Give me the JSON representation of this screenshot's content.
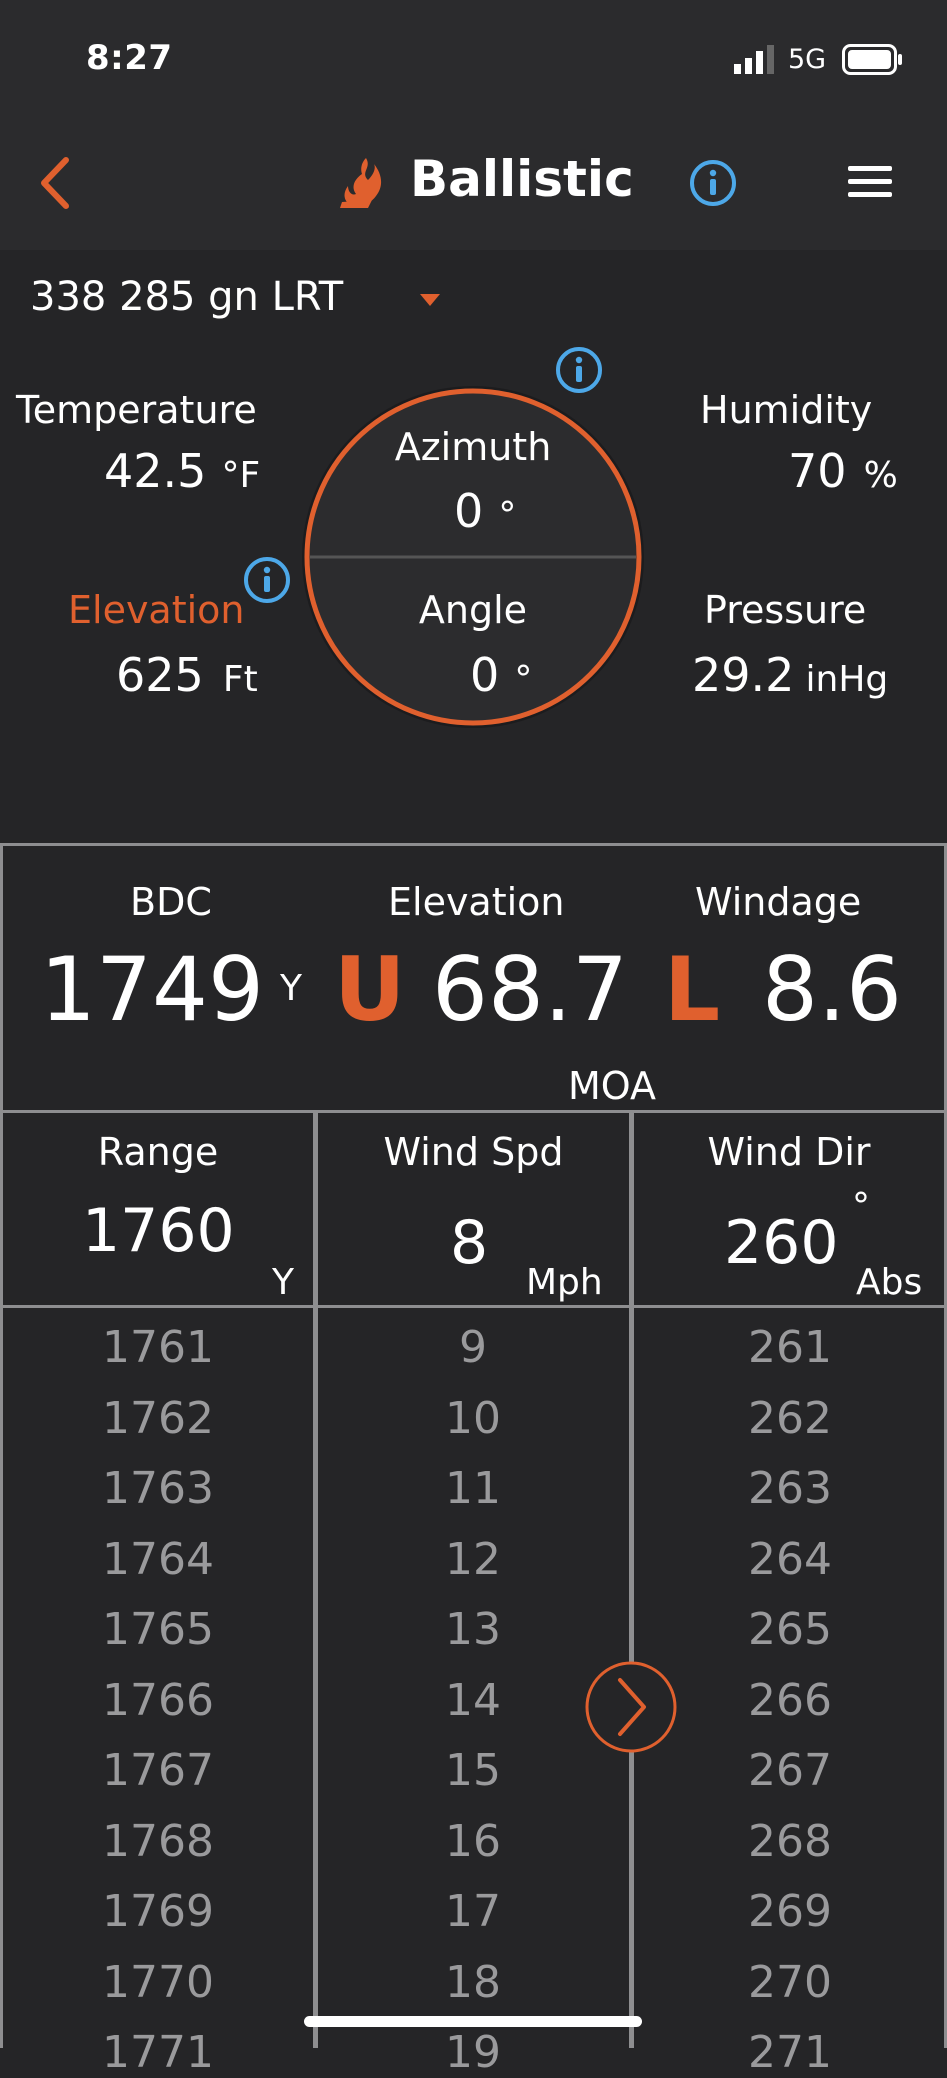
{
  "status": {
    "time": "8:27",
    "network": "5G"
  },
  "nav": {
    "title": "Ballistic"
  },
  "profile": {
    "name": "338 285 gn LRT"
  },
  "env": {
    "temperature": {
      "label": "Temperature",
      "value": "42.5",
      "unit": "°F"
    },
    "humidity": {
      "label": "Humidity",
      "value": "70",
      "unit": "%"
    },
    "elevation": {
      "label": "Elevation",
      "value": "625",
      "unit": "Ft"
    },
    "pressure": {
      "label": "Pressure",
      "value": "29.2",
      "unit": "inHg"
    }
  },
  "dial": {
    "azimuth": {
      "label": "Azimuth",
      "value": "0",
      "unit": "°"
    },
    "angle": {
      "label": "Angle",
      "value": "0",
      "unit": "°"
    }
  },
  "solution": {
    "bdc": {
      "label": "BDC",
      "value": "1749",
      "unit": "Y"
    },
    "elevation": {
      "label": "Elevation",
      "dir": "U",
      "value": "68.7"
    },
    "windage": {
      "label": "Windage",
      "dir": "L",
      "value": "8.6"
    },
    "units": "MOA"
  },
  "inputs": {
    "range": {
      "label": "Range",
      "value": "1760",
      "unit": "Y"
    },
    "wind_speed": {
      "label": "Wind Spd",
      "value": "8",
      "unit": "Mph"
    },
    "wind_dir": {
      "label": "Wind Dir",
      "value": "260",
      "deg": "°",
      "unit": "Abs"
    }
  },
  "pickers": {
    "range": [
      "1761",
      "1762",
      "1763",
      "1764",
      "1765",
      "1766",
      "1767",
      "1768",
      "1769",
      "1770",
      "1771"
    ],
    "wind_speed": [
      "9",
      "10",
      "11",
      "12",
      "13",
      "14",
      "15",
      "16",
      "17",
      "18",
      "19"
    ],
    "wind_dir": [
      "261",
      "262",
      "263",
      "264",
      "265",
      "266",
      "267",
      "268",
      "269",
      "270",
      "271"
    ]
  },
  "colors": {
    "accent": "#e0602e",
    "info": "#4da8e8",
    "background": "#252527"
  }
}
